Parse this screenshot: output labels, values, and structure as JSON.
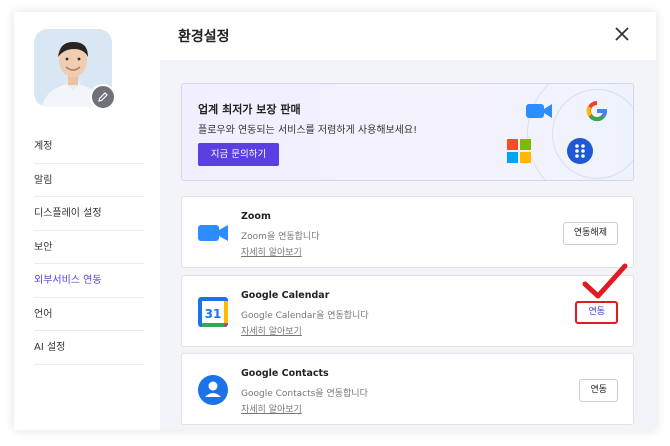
{
  "header": {
    "title": "환경설정",
    "close_icon": "close-icon"
  },
  "sidebar": {
    "items": [
      {
        "label": "계정",
        "active": false
      },
      {
        "label": "알림",
        "active": false
      },
      {
        "label": "디스플레이 설정",
        "active": false
      },
      {
        "label": "보안",
        "active": false
      },
      {
        "label": "외부서비스 연동",
        "active": true
      },
      {
        "label": "언어",
        "active": false
      },
      {
        "label": "AI 설정",
        "active": false
      }
    ]
  },
  "banner": {
    "title": "업계 최저가 보장 판매",
    "description": "플로우와 연동되는 서비스를 저렴하게 사용해보세요!",
    "button_label": "지금 문의하기"
  },
  "services": [
    {
      "name": "Zoom",
      "description": "Zoom을 연동합니다",
      "link_label": "자세히 알아보기",
      "button_label": "연동해제",
      "icon": "zoom-icon"
    },
    {
      "name": "Google Calendar",
      "description": "Google Calendar을 연동합니다",
      "link_label": "자세히 알아보기",
      "button_label": "연동",
      "icon": "google-calendar-icon"
    },
    {
      "name": "Google Contacts",
      "description": "Google Contacts을 연동합니다",
      "link_label": "자세히 알아보기",
      "button_label": "연동",
      "icon": "google-contacts-icon"
    }
  ],
  "colors": {
    "accent": "#5b3fe0",
    "highlight": "#e01b24"
  }
}
